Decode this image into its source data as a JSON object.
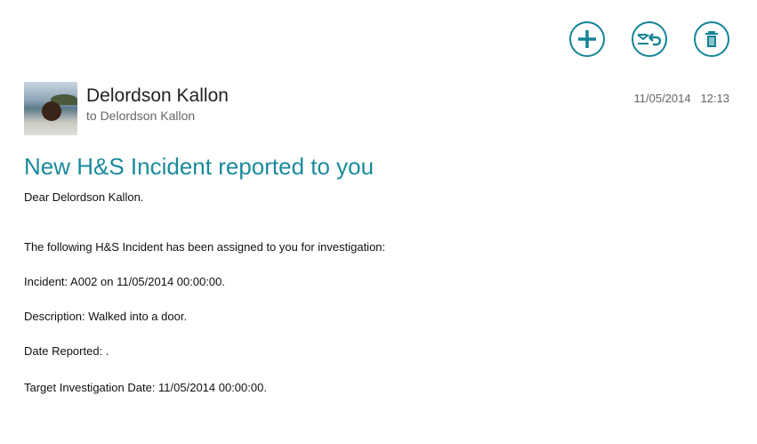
{
  "toolbar": {
    "new": "add-icon",
    "respond": "reply-icon",
    "delete": "delete-icon",
    "accent": "#138496"
  },
  "message": {
    "sender": "Delordson Kallon",
    "to": "to Delordson Kallon",
    "date": "11/05/2014",
    "time": "12:13",
    "subject": "New H&S Incident reported to you",
    "body": [
      "Dear Delordson Kallon.",
      "The following H&S Incident has been assigned to you for investigation:",
      "Incident: A002 on 11/05/2014 00:00:00.",
      "Description: Walked into a door.",
      "Date Reported: .",
      "Target Investigation Date: 11/05/2014 00:00:00."
    ]
  }
}
